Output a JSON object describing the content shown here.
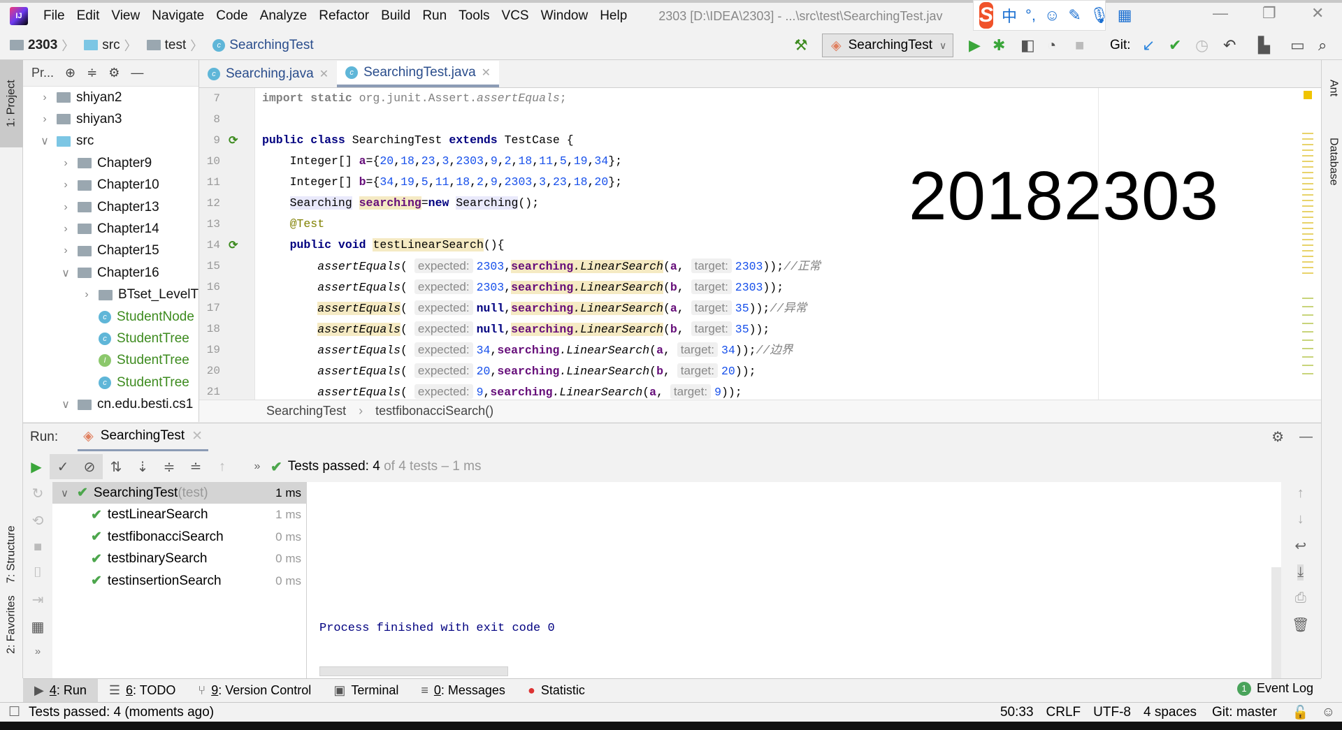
{
  "menubar": {
    "items": [
      "File",
      "Edit",
      "View",
      "Navigate",
      "Code",
      "Analyze",
      "Refactor",
      "Build",
      "Run",
      "Tools",
      "VCS",
      "Window",
      "Help"
    ],
    "window_title": "2303 [D:\\IDEA\\2303] - ...\\src\\test\\SearchingTest.jav"
  },
  "ime": {
    "logo": "S",
    "mode": "中",
    "punct": "°,"
  },
  "navbar": {
    "crumbs": [
      "2303",
      "src",
      "test",
      "SearchingTest"
    ],
    "run_config": "SearchingTest",
    "git_label": "Git:"
  },
  "left_stripe": {
    "project": "1: Project",
    "structure": "7: Structure",
    "favorites": "2: Favorites"
  },
  "right_stripe": {
    "ant": "Ant",
    "database": "Database"
  },
  "project_panel": {
    "title": "Pr...",
    "tree": [
      {
        "label": "shiyan2",
        "level": 0,
        "chev": ">",
        "kind": "folder"
      },
      {
        "label": "shiyan3",
        "level": 0,
        "chev": ">",
        "kind": "folder"
      },
      {
        "label": "src",
        "level": 0,
        "chev": "v",
        "kind": "srcfolder"
      },
      {
        "label": "Chapter9",
        "level": 1,
        "chev": ">",
        "kind": "package"
      },
      {
        "label": "Chapter10",
        "level": 1,
        "chev": ">",
        "kind": "package"
      },
      {
        "label": "Chapter13",
        "level": 1,
        "chev": ">",
        "kind": "package"
      },
      {
        "label": "Chapter14",
        "level": 1,
        "chev": ">",
        "kind": "package"
      },
      {
        "label": "Chapter15",
        "level": 1,
        "chev": ">",
        "kind": "package"
      },
      {
        "label": "Chapter16",
        "level": 1,
        "chev": "v",
        "kind": "package"
      },
      {
        "label": "BTset_LevelT",
        "level": 2,
        "chev": ">",
        "kind": "package"
      },
      {
        "label": "StudentNode",
        "level": 2,
        "chev": "",
        "kind": "class"
      },
      {
        "label": "StudentTree",
        "level": 2,
        "chev": "",
        "kind": "class"
      },
      {
        "label": "StudentTree",
        "level": 2,
        "chev": "",
        "kind": "interface"
      },
      {
        "label": "StudentTree",
        "level": 2,
        "chev": "",
        "kind": "testclass"
      },
      {
        "label": "cn.edu.besti.cs1",
        "level": 1,
        "chev": "v",
        "kind": "package"
      }
    ]
  },
  "editor": {
    "tabs": [
      {
        "label": "Searching.java",
        "active": false
      },
      {
        "label": "SearchingTest.java",
        "active": true
      }
    ],
    "overlay_text": "20182303",
    "lines": [
      {
        "n": "7",
        "tokens": [
          [
            "import static ",
            "kw imp"
          ],
          [
            "org.junit.Assert.",
            "imp"
          ],
          [
            "assertEquals",
            "imp ital"
          ],
          [
            ";",
            "imp"
          ]
        ]
      },
      {
        "n": "8",
        "tokens": []
      },
      {
        "n": "9",
        "gutter": "run",
        "tokens": [
          [
            "public class ",
            "kw"
          ],
          [
            "SearchingTest ",
            ""
          ],
          [
            "extends ",
            "kw"
          ],
          [
            "TestCase {",
            ""
          ]
        ]
      },
      {
        "n": "10",
        "tokens": [
          [
            "    Integer[] ",
            ""
          ],
          [
            "a",
            "fld"
          ],
          [
            "={",
            ""
          ],
          [
            "20",
            "num"
          ],
          [
            ",",
            ""
          ],
          [
            "18",
            "num"
          ],
          [
            ",",
            ""
          ],
          [
            "23",
            "num"
          ],
          [
            ",",
            ""
          ],
          [
            "3",
            "num"
          ],
          [
            ",",
            ""
          ],
          [
            "2303",
            "num"
          ],
          [
            ",",
            ""
          ],
          [
            "9",
            "num"
          ],
          [
            ",",
            ""
          ],
          [
            "2",
            "num"
          ],
          [
            ",",
            ""
          ],
          [
            "18",
            "num"
          ],
          [
            ",",
            ""
          ],
          [
            "11",
            "num"
          ],
          [
            ",",
            ""
          ],
          [
            "5",
            "num"
          ],
          [
            ",",
            ""
          ],
          [
            "19",
            "num"
          ],
          [
            ",",
            ""
          ],
          [
            "34",
            "num"
          ],
          [
            "};",
            ""
          ]
        ]
      },
      {
        "n": "11",
        "tokens": [
          [
            "    Integer[] ",
            ""
          ],
          [
            "b",
            "fld"
          ],
          [
            "={",
            ""
          ],
          [
            "34",
            "num"
          ],
          [
            ",",
            ""
          ],
          [
            "19",
            "num"
          ],
          [
            ",",
            ""
          ],
          [
            "5",
            "num"
          ],
          [
            ",",
            ""
          ],
          [
            "11",
            "num"
          ],
          [
            ",",
            ""
          ],
          [
            "18",
            "num"
          ],
          [
            ",",
            ""
          ],
          [
            "2",
            "num"
          ],
          [
            ",",
            ""
          ],
          [
            "9",
            "num"
          ],
          [
            ",",
            ""
          ],
          [
            "2303",
            "num"
          ],
          [
            ",",
            ""
          ],
          [
            "3",
            "num"
          ],
          [
            ",",
            ""
          ],
          [
            "23",
            "num"
          ],
          [
            ",",
            ""
          ],
          [
            "18",
            "num"
          ],
          [
            ",",
            ""
          ],
          [
            "20",
            "num"
          ],
          [
            "};",
            ""
          ]
        ]
      },
      {
        "n": "12",
        "tokens": [
          [
            "    ",
            ""
          ],
          [
            "Searching",
            "cls"
          ],
          [
            " ",
            ""
          ],
          [
            "searching",
            "fld hl"
          ],
          [
            "=",
            ""
          ],
          [
            "new ",
            "kw"
          ],
          [
            "Searching",
            "cls"
          ],
          [
            "();",
            ""
          ]
        ]
      },
      {
        "n": "13",
        "tokens": [
          [
            "    @Test",
            "ann"
          ]
        ]
      },
      {
        "n": "14",
        "gutter": "run",
        "tokens": [
          [
            "    public void ",
            "kw"
          ],
          [
            "testLinearSearch",
            "hl"
          ],
          [
            "(){",
            ""
          ]
        ]
      },
      {
        "n": "15",
        "tokens": [
          [
            "        assertEquals",
            "ital"
          ],
          [
            "( ",
            ""
          ],
          [
            "expected:",
            "hint"
          ],
          [
            "2303",
            "num"
          ],
          [
            ",",
            ""
          ],
          [
            "searching",
            "fld hl"
          ],
          [
            ".LinearSearch",
            "ital hl"
          ],
          [
            "(",
            ""
          ],
          [
            "a",
            "fld"
          ],
          [
            ", ",
            ""
          ],
          [
            "target:",
            "hint"
          ],
          [
            "2303",
            "num"
          ],
          [
            "));",
            ""
          ],
          [
            "//正常",
            "cmt"
          ]
        ]
      },
      {
        "n": "16",
        "tokens": [
          [
            "        assertEquals",
            "ital"
          ],
          [
            "( ",
            ""
          ],
          [
            "expected:",
            "hint"
          ],
          [
            "2303",
            "num"
          ],
          [
            ",",
            ""
          ],
          [
            "searching",
            "fld hl"
          ],
          [
            ".LinearSearch",
            "ital hl"
          ],
          [
            "(",
            ""
          ],
          [
            "b",
            "fld"
          ],
          [
            ", ",
            ""
          ],
          [
            "target:",
            "hint"
          ],
          [
            "2303",
            "num"
          ],
          [
            "));",
            ""
          ]
        ]
      },
      {
        "n": "17",
        "tokens": [
          [
            "        ",
            ""
          ],
          [
            "assertEquals",
            "ital hl"
          ],
          [
            "( ",
            ""
          ],
          [
            "expected:",
            "hint"
          ],
          [
            "null",
            "kw"
          ],
          [
            ",",
            ""
          ],
          [
            "searching",
            "fld hl"
          ],
          [
            ".LinearSearch",
            "ital hl"
          ],
          [
            "(",
            ""
          ],
          [
            "a",
            "fld"
          ],
          [
            ", ",
            ""
          ],
          [
            "target:",
            "hint"
          ],
          [
            "35",
            "num"
          ],
          [
            "));",
            ""
          ],
          [
            "//异常",
            "cmt"
          ]
        ]
      },
      {
        "n": "18",
        "tokens": [
          [
            "        ",
            ""
          ],
          [
            "assertEquals",
            "ital hl"
          ],
          [
            "( ",
            ""
          ],
          [
            "expected:",
            "hint"
          ],
          [
            "null",
            "kw"
          ],
          [
            ",",
            ""
          ],
          [
            "searching",
            "fld hl"
          ],
          [
            ".LinearSearch",
            "ital hl"
          ],
          [
            "(",
            ""
          ],
          [
            "b",
            "fld"
          ],
          [
            ", ",
            ""
          ],
          [
            "target:",
            "hint"
          ],
          [
            "35",
            "num"
          ],
          [
            "));",
            ""
          ]
        ]
      },
      {
        "n": "19",
        "tokens": [
          [
            "        assertEquals",
            "ital"
          ],
          [
            "( ",
            ""
          ],
          [
            "expected:",
            "hint"
          ],
          [
            "34",
            "num"
          ],
          [
            ",",
            ""
          ],
          [
            "searching",
            "fld"
          ],
          [
            ".LinearSearch",
            "ital"
          ],
          [
            "(",
            ""
          ],
          [
            "a",
            "fld"
          ],
          [
            ", ",
            ""
          ],
          [
            "target:",
            "hint"
          ],
          [
            "34",
            "num"
          ],
          [
            "));",
            ""
          ],
          [
            "//边界",
            "cmt"
          ]
        ]
      },
      {
        "n": "20",
        "tokens": [
          [
            "        assertEquals",
            "ital"
          ],
          [
            "( ",
            ""
          ],
          [
            "expected:",
            "hint"
          ],
          [
            "20",
            "num"
          ],
          [
            ",",
            ""
          ],
          [
            "searching",
            "fld"
          ],
          [
            ".LinearSearch",
            "ital"
          ],
          [
            "(",
            ""
          ],
          [
            "b",
            "fld"
          ],
          [
            ", ",
            ""
          ],
          [
            "target:",
            "hint"
          ],
          [
            "20",
            "num"
          ],
          [
            "));",
            ""
          ]
        ]
      },
      {
        "n": "21",
        "tokens": [
          [
            "        assertEquals",
            "ital"
          ],
          [
            "( ",
            ""
          ],
          [
            "expected:",
            "hint"
          ],
          [
            "9",
            "num"
          ],
          [
            ",",
            ""
          ],
          [
            "searching",
            "fld"
          ],
          [
            ".LinearSearch",
            "ital"
          ],
          [
            "(",
            ""
          ],
          [
            "a",
            "fld"
          ],
          [
            ", ",
            ""
          ],
          [
            "target:",
            "hint"
          ],
          [
            "9",
            "num"
          ],
          [
            "));",
            ""
          ]
        ]
      }
    ],
    "breadcrumb": [
      "SearchingTest",
      "testfibonacciSearch()"
    ]
  },
  "run": {
    "label": "Run:",
    "tab": "SearchingTest",
    "status_main": "Tests passed: 4",
    "status_rest": " of 4 tests – 1 ms",
    "tree": [
      {
        "name": "SearchingTest",
        "suffix": " (test)",
        "time": "1 ms",
        "root": true
      },
      {
        "name": "testLinearSearch",
        "time": "1 ms"
      },
      {
        "name": "testfibonacciSearch",
        "time": "0 ms"
      },
      {
        "name": "testbinarySearch",
        "time": "0 ms"
      },
      {
        "name": "testinsertionSearch",
        "time": "0 ms"
      }
    ],
    "console": "Process finished with exit code 0"
  },
  "bottom_tabs": [
    {
      "key": "4",
      "label": ": Run",
      "icon": "▶",
      "active": true
    },
    {
      "key": "6",
      "label": ": TODO",
      "icon": "☰"
    },
    {
      "key": "9",
      "label": ": Version Control",
      "icon": "⑂"
    },
    {
      "key": "",
      "label": "Terminal",
      "icon": "▣"
    },
    {
      "key": "0",
      "label": ": Messages",
      "icon": "≡"
    },
    {
      "key": "",
      "label": "Statistic",
      "icon": "●"
    }
  ],
  "event_log": {
    "count": "1",
    "label": "Event Log"
  },
  "status": {
    "message": "Tests passed: 4 (moments ago)",
    "position": "50:33",
    "line_sep": "CRLF",
    "encoding": "UTF-8",
    "indent": "4 spaces",
    "branch": "Git: master"
  },
  "colors": {
    "pass": "#4ca64c",
    "keyword": "#000080",
    "number": "#1750eb",
    "field": "#660e7a",
    "console": "#000080"
  }
}
